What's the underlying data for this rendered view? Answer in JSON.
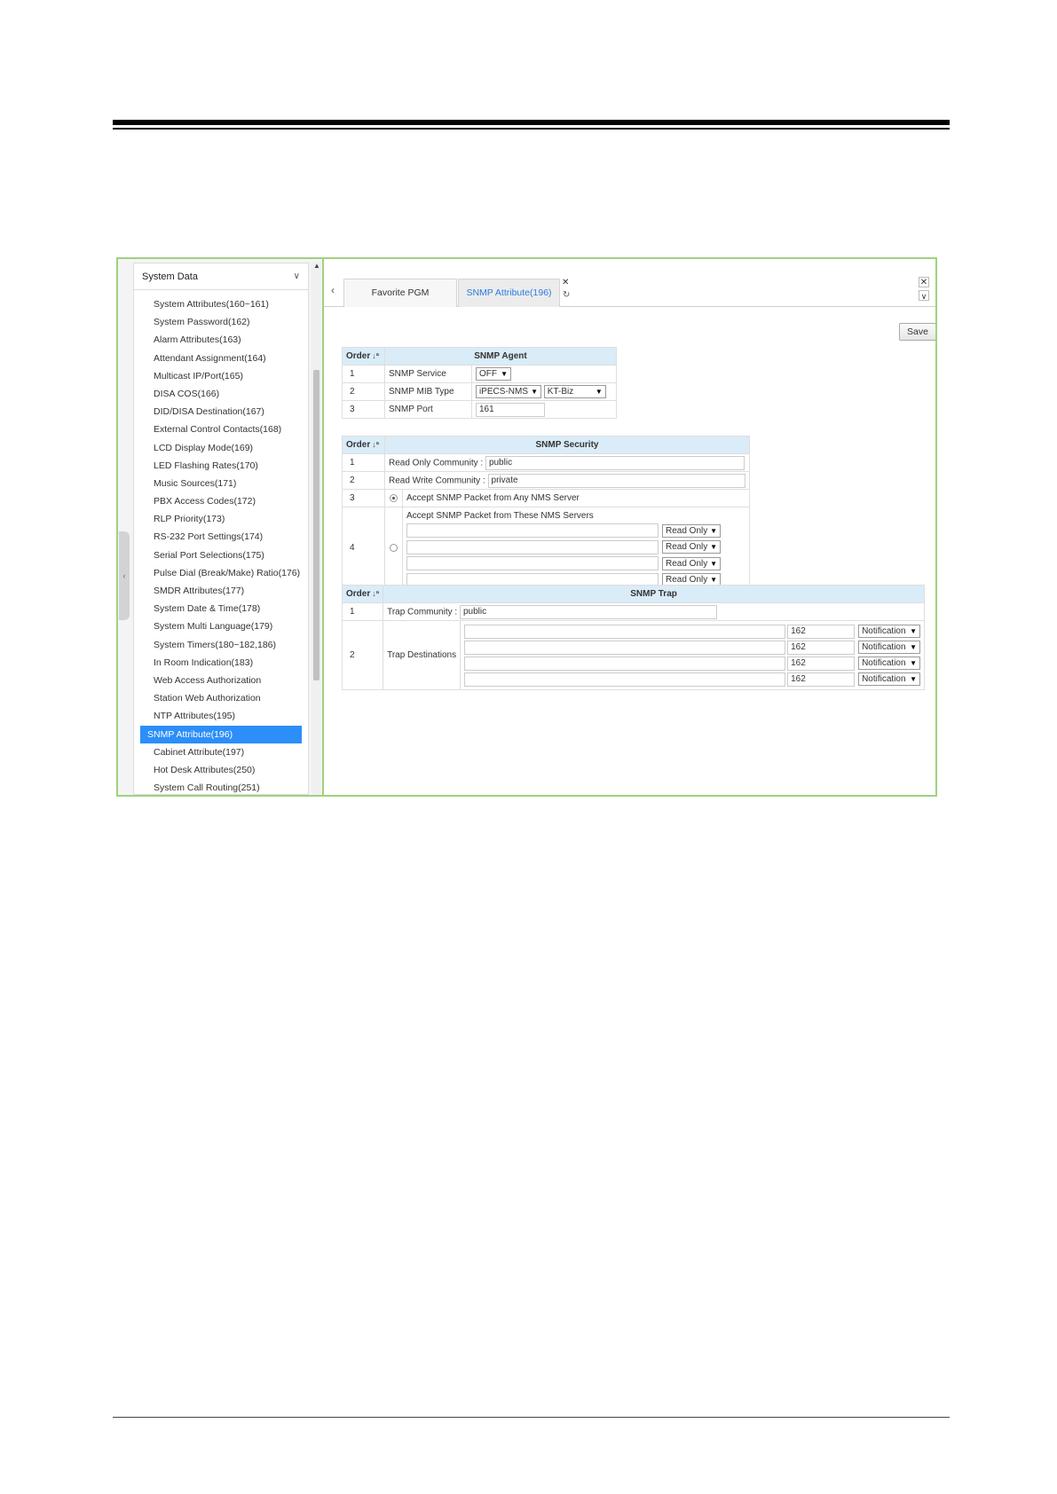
{
  "left_nav": {
    "header": "System Data",
    "items": [
      "System Attributes(160~161)",
      "System Password(162)",
      "Alarm Attributes(163)",
      "Attendant Assignment(164)",
      "Multicast IP/Port(165)",
      "DISA COS(166)",
      "DID/DISA Destination(167)",
      "External Control Contacts(168)",
      "LCD Display Mode(169)",
      "LED Flashing Rates(170)",
      "Music Sources(171)",
      "PBX Access Codes(172)",
      "RLP Priority(173)",
      "RS-232 Port Settings(174)",
      "Serial Port Selections(175)",
      "Pulse Dial (Break/Make) Ratio(176)",
      "SMDR Attributes(177)",
      "System Date & Time(178)",
      "System Multi Language(179)",
      "System Timers(180~182,186)",
      "In Room Indication(183)",
      "Web Access Authorization",
      "Station Web Authorization",
      "NTP Attributes(195)",
      "SNMP Attribute(196)",
      "Cabinet Attribute(197)",
      "Hot Desk Attributes(250)",
      "System Call Routing(251)"
    ],
    "active_index": 24
  },
  "tabs": {
    "favorite": "Favorite PGM",
    "snmp": "SNMP Attribute(196)"
  },
  "toolbar": {
    "save_label": "Save"
  },
  "agent": {
    "order_label": "Order",
    "title": "SNMP Agent",
    "rows": [
      {
        "no": "1",
        "label": "SNMP Service",
        "value": "OFF"
      },
      {
        "no": "2",
        "label": "SNMP MIB Type",
        "value": "iPECS-NMS",
        "value2": "KT-Biz"
      },
      {
        "no": "3",
        "label": "SNMP Port",
        "value": "161"
      }
    ]
  },
  "security": {
    "order_label": "Order",
    "title": "SNMP Security",
    "rows": [
      {
        "no": "1",
        "label": "Read Only Community :",
        "value": "public"
      },
      {
        "no": "2",
        "label": "Read Write Community :",
        "value": "private"
      },
      {
        "no": "3",
        "label": "Accept SNMP Packet from Any NMS Server"
      },
      {
        "no": "4",
        "label": "Accept SNMP Packet from These NMS Servers"
      }
    ],
    "servers": [
      {
        "ip": "",
        "access": "Read Only"
      },
      {
        "ip": "",
        "access": "Read Only"
      },
      {
        "ip": "",
        "access": "Read Only"
      },
      {
        "ip": "",
        "access": "Read Only"
      }
    ]
  },
  "trap": {
    "order_label": "Order",
    "title": "SNMP Trap",
    "rows": [
      {
        "no": "1",
        "label": "Trap Community :",
        "value": "public"
      },
      {
        "no": "2",
        "label": "Trap Destinations"
      }
    ],
    "destinations": [
      {
        "ip": "",
        "port": "162",
        "type": "Notification"
      },
      {
        "ip": "",
        "port": "162",
        "type": "Notification"
      },
      {
        "ip": "",
        "port": "162",
        "type": "Notification"
      },
      {
        "ip": "",
        "port": "162",
        "type": "Notification"
      }
    ]
  }
}
